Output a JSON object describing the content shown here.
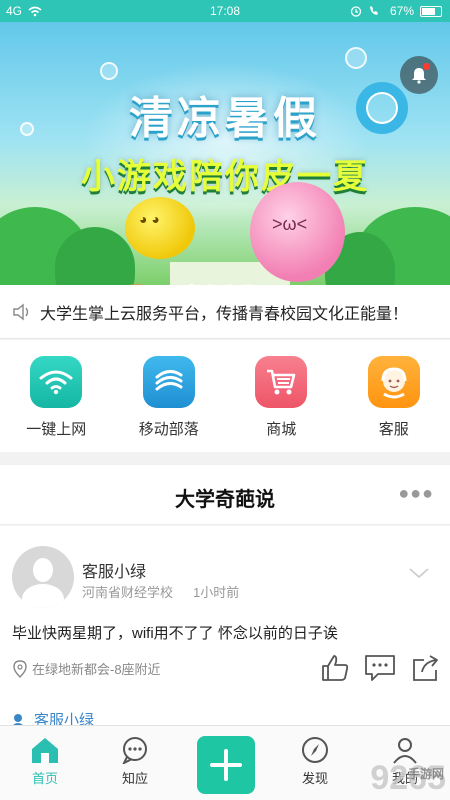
{
  "status": {
    "time": "17:08",
    "battery": "67%",
    "signal": "4G"
  },
  "banner": {
    "title": "清凉暑假",
    "subtitle": "小游戏陪你皮一夏",
    "page_count": 4,
    "active_page": 1
  },
  "notice": {
    "text": "大学生掌上云服务平台，传播青春校园文化正能量！"
  },
  "quick_menu": [
    {
      "label": "一键上网",
      "color": "#1fc4b0",
      "icon": "wifi-icon"
    },
    {
      "label": "移动部落",
      "color": "#2aa3e0",
      "icon": "china-mobile-icon"
    },
    {
      "label": "商城",
      "color": "#f2667a",
      "icon": "cart-icon"
    },
    {
      "label": "客服",
      "color": "#ff9f1c",
      "icon": "customer-service-icon"
    }
  ],
  "feed": {
    "title": "大学奇葩说",
    "post": {
      "username": "客服小绿",
      "school": "河南省财经学校",
      "time": "1小时前",
      "content": "毕业快两星期了，wifi用不了了 怀念以前的日子诶",
      "location": "在绿地新都会-8座附近"
    },
    "next_post_user": "客服小绿"
  },
  "tabbar": [
    {
      "label": "首页",
      "icon": "home-icon",
      "active": true
    },
    {
      "label": "知应",
      "icon": "chat-icon",
      "active": false
    },
    {
      "label": "发现",
      "icon": "compass-icon",
      "active": false
    },
    {
      "label": "我的",
      "icon": "user-icon",
      "active": false
    }
  ],
  "watermark": {
    "brand": "9265",
    "sub": "手游网"
  },
  "colors": {
    "accent": "#2ec5b6",
    "link": "#3a87c8"
  }
}
